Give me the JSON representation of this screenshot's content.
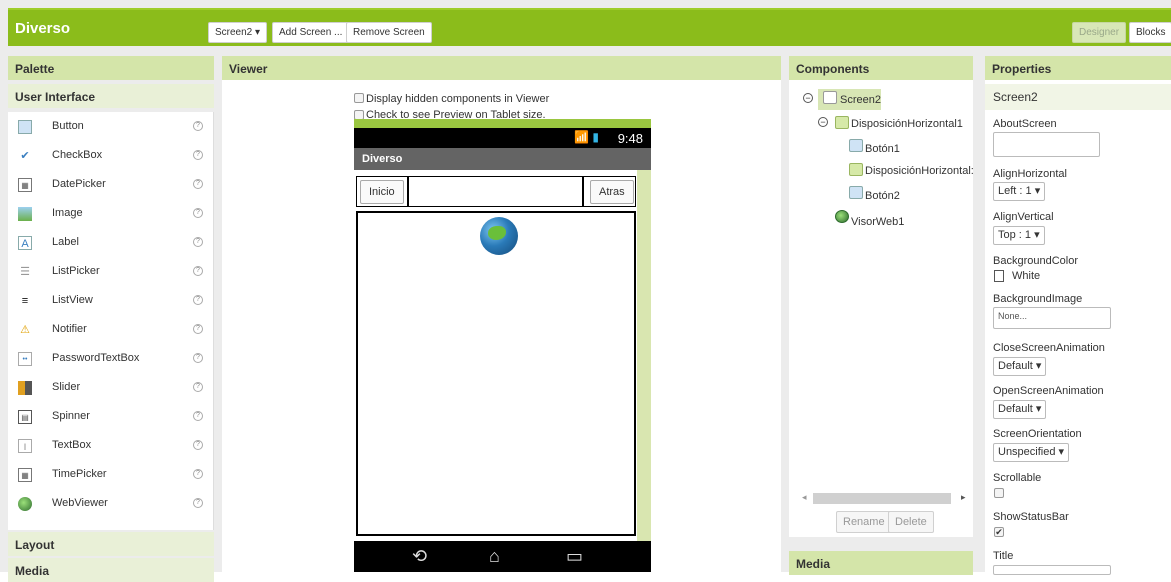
{
  "app": {
    "title": "Diverso",
    "screen_select": "Screen2 ▾",
    "add_screen": "Add Screen ...",
    "remove_screen": "Remove Screen",
    "designer": "Designer",
    "blocks": "Blocks"
  },
  "palette": {
    "title": "Palette",
    "section": "User Interface",
    "items": [
      {
        "label": "Button",
        "icon": "button-icon"
      },
      {
        "label": "CheckBox",
        "icon": "checkbox-icon"
      },
      {
        "label": "DatePicker",
        "icon": "datepicker-icon"
      },
      {
        "label": "Image",
        "icon": "image-icon"
      },
      {
        "label": "Label",
        "icon": "label-icon"
      },
      {
        "label": "ListPicker",
        "icon": "listpicker-icon"
      },
      {
        "label": "ListView",
        "icon": "listview-icon"
      },
      {
        "label": "Notifier",
        "icon": "notifier-icon"
      },
      {
        "label": "PasswordTextBox",
        "icon": "password-icon"
      },
      {
        "label": "Slider",
        "icon": "slider-icon"
      },
      {
        "label": "Spinner",
        "icon": "spinner-icon"
      },
      {
        "label": "TextBox",
        "icon": "textbox-icon"
      },
      {
        "label": "TimePicker",
        "icon": "timepicker-icon"
      },
      {
        "label": "WebViewer",
        "icon": "webviewer-icon"
      }
    ],
    "help_glyph": "?",
    "layout_section": "Layout",
    "media_section": "Media"
  },
  "viewer": {
    "title": "Viewer",
    "hidden_components": "Display hidden components in Viewer",
    "tablet_preview": "Check to see Preview on Tablet size.",
    "phone": {
      "time": "9:48",
      "status_icons": "📶 ▮",
      "app_title": "Diverso",
      "btn_inicio": "Inicio",
      "btn_atras": "Atras"
    }
  },
  "components": {
    "title": "Components",
    "tree": {
      "screen": "Screen2",
      "horiz1": "DisposiciónHorizontal1",
      "boton1": "Botón1",
      "horiz2": "DisposiciónHorizontal:",
      "boton2": "Botón2",
      "visor": "VisorWeb1"
    },
    "rename": "Rename",
    "delete": "Delete",
    "media_title": "Media"
  },
  "properties": {
    "title": "Properties",
    "component": "Screen2",
    "about_screen": "AboutScreen",
    "align_horizontal": "AlignHorizontal",
    "align_horizontal_value": "Left : 1 ▾",
    "align_vertical": "AlignVertical",
    "align_vertical_value": "Top : 1 ▾",
    "background_color": "BackgroundColor",
    "background_color_value": "White",
    "background_image": "BackgroundImage",
    "background_image_value": "None...",
    "close_anim": "CloseScreenAnimation",
    "close_anim_value": "Default ▾",
    "open_anim": "OpenScreenAnimation",
    "open_anim_value": "Default ▾",
    "orientation": "ScreenOrientation",
    "orientation_value": "Unspecified ▾",
    "scrollable": "Scrollable",
    "scrollable_checked": false,
    "show_status_bar": "ShowStatusBar",
    "show_status_bar_checked": true,
    "title_prop": "Title"
  },
  "colors": {
    "brand_green": "#8bbc1b",
    "panel_header": "#d4e5a9"
  }
}
